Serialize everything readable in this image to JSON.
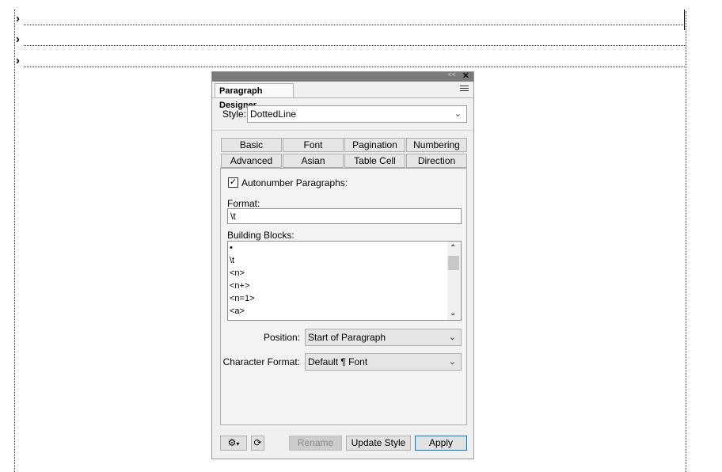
{
  "document": {
    "tab_glyph": "›"
  },
  "panel": {
    "title": "Paragraph Designer",
    "collapse_glyph": "<<",
    "close_glyph": "✕",
    "style_label": "Style:",
    "style_value": "DottedLine",
    "tabs_row1": [
      "Basic",
      "Font",
      "Pagination",
      "Numbering"
    ],
    "tabs_row2": [
      "Advanced",
      "Asian",
      "Table Cell",
      "Direction"
    ],
    "active_tab": "Numbering",
    "autonumber_label": "Autonumber Paragraphs:",
    "autonumber_checked": true,
    "format_label": "Format:",
    "format_value": "\\t",
    "building_blocks_label": "Building Blocks:",
    "building_blocks": [
      "•",
      "\\t",
      "<n>",
      "<n+>",
      "<n=1>",
      "<a>"
    ],
    "position_label": "Position:",
    "position_value": "Start of Paragraph",
    "char_format_label": "Character Format:",
    "char_format_value": "Default ¶ Font",
    "buttons": {
      "rename": "Rename",
      "update_style": "Update Style",
      "apply": "Apply"
    },
    "icons": {
      "gear": "gear-icon",
      "refresh": "refresh-icon",
      "menu": "menu-icon"
    }
  }
}
